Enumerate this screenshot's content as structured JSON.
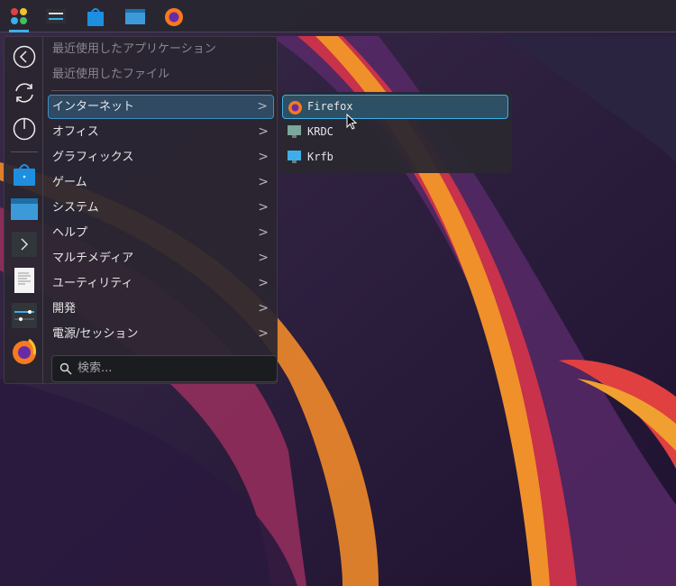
{
  "taskbar": {
    "items": [
      "application-launcher-icon",
      "system-settings-icon",
      "discover-icon",
      "file-manager-icon",
      "firefox-icon"
    ]
  },
  "menu": {
    "recent_apps": "最近使用したアプリケーション",
    "recent_files": "最近使用したファイル",
    "categories": [
      "インターネット",
      "オフィス",
      "グラフィックス",
      "ゲーム",
      "システム",
      "ヘルプ",
      "マルチメディア",
      "ユーティリティ",
      "開発",
      "電源/セッション"
    ],
    "search_placeholder": "検索..."
  },
  "submenu": {
    "items": [
      "Firefox",
      "KRDC",
      "Krfb"
    ]
  },
  "colors": {
    "accent": "#3daee9"
  }
}
